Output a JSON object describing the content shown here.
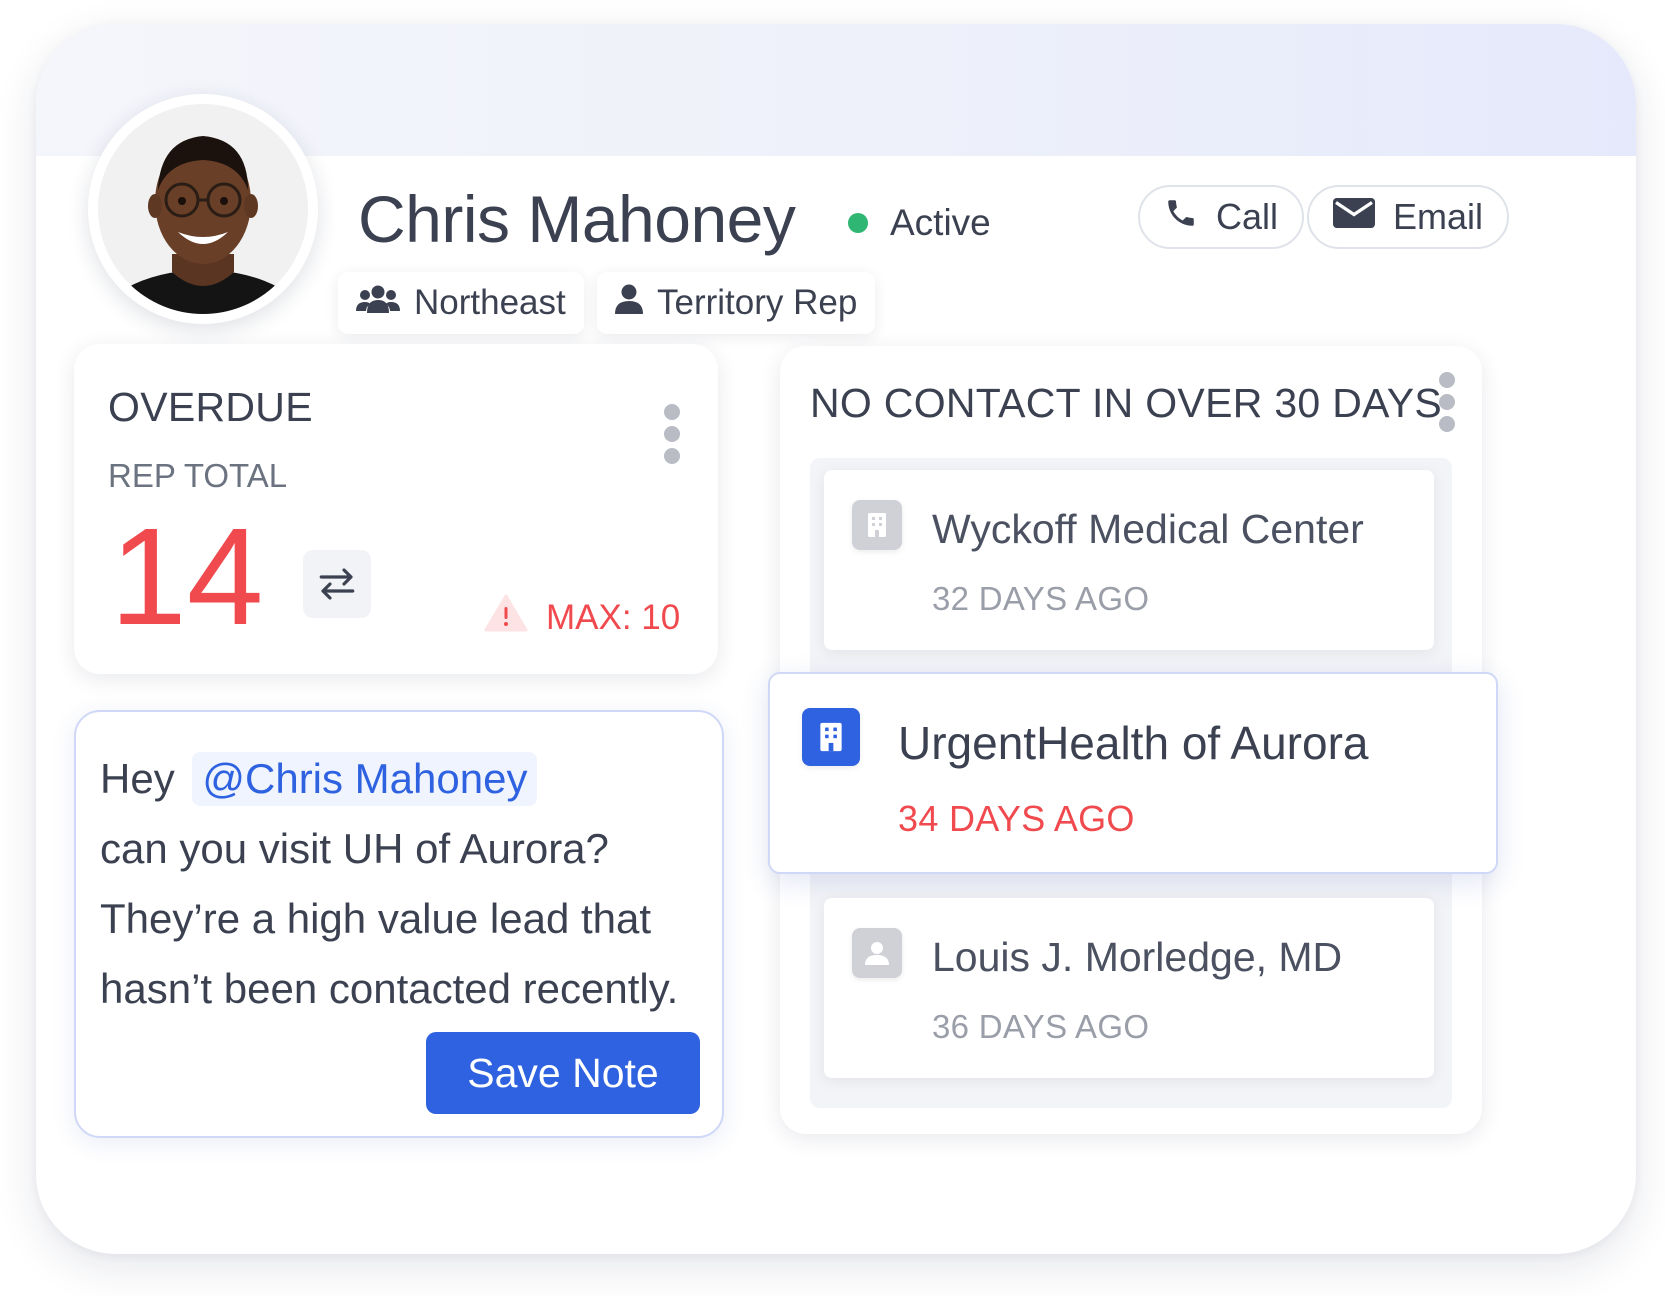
{
  "profile": {
    "name": "Chris Mahoney",
    "status": "Active",
    "region": "Northeast",
    "role": "Territory Rep",
    "status_color": "#2fb672"
  },
  "actions": {
    "call_label": "Call",
    "email_label": "Email"
  },
  "overdue": {
    "title": "OVERDUE",
    "subtitle": "REP TOTAL",
    "value": "14",
    "max_label": "MAX: 10",
    "alert_color": "#f0494e"
  },
  "note": {
    "greeting": "Hey",
    "mention": "@Chris Mahoney",
    "body": "can you visit UH of Aurora? They’re a high value lead that hasn’t been contacted recently.",
    "save_label": "Save Note"
  },
  "no_contact": {
    "title": "NO CONTACT IN OVER 30 DAYS",
    "items": [
      {
        "name": "Wyckoff Medical Center",
        "age": "32 DAYS AGO",
        "icon": "building-icon",
        "highlighted": false
      },
      {
        "name": "UrgentHealth of Aurora",
        "age": "34 DAYS AGO",
        "icon": "building-icon",
        "highlighted": true
      },
      {
        "name": "Louis J. Morledge, MD",
        "age": "36 DAYS AGO",
        "icon": "person-icon",
        "highlighted": false
      }
    ]
  },
  "colors": {
    "accent": "#2f62e0",
    "danger": "#f0494e"
  }
}
